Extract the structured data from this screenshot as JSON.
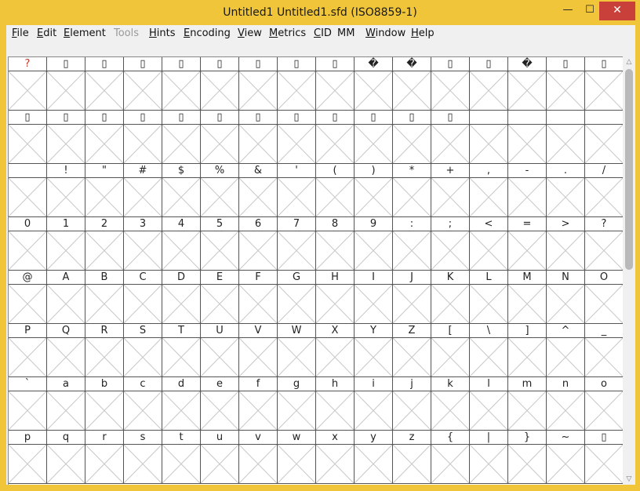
{
  "window": {
    "title": "Untitled1  Untitled1.sfd (ISO8859-1)",
    "minimize_glyph": "—",
    "maximize_glyph": "☐",
    "close_glyph": "✕"
  },
  "menu": [
    {
      "mnemonic": "F",
      "rest": "ile",
      "enabled": true
    },
    {
      "mnemonic": "E",
      "rest": "dit",
      "enabled": true
    },
    {
      "mnemonic": "E",
      "rest": "lement",
      "enabled": true
    },
    {
      "mnemonic": "",
      "rest": "Tools",
      "enabled": false
    },
    {
      "mnemonic": "H",
      "rest": "ints",
      "enabled": true
    },
    {
      "mnemonic": "E",
      "rest": "ncoding",
      "enabled": true
    },
    {
      "mnemonic": "V",
      "rest": "iew",
      "enabled": true
    },
    {
      "mnemonic": "M",
      "rest": "etrics",
      "enabled": true
    },
    {
      "mnemonic": "C",
      "rest": "ID",
      "enabled": true
    },
    {
      "mnemonic": "",
      "rest": "MM",
      "enabled": true
    },
    {
      "mnemonic": "W",
      "rest": "indow",
      "enabled": true
    },
    {
      "mnemonic": "H",
      "rest": "elp",
      "enabled": true
    }
  ],
  "glyph_rows": [
    [
      "?",
      "▯",
      "▯",
      "▯",
      "▯",
      "▯",
      "▯",
      "▯",
      "▯",
      "�",
      "�",
      "▯",
      "▯",
      "�",
      "▯",
      "▯"
    ],
    [
      "▯",
      "▯",
      "▯",
      "▯",
      "▯",
      "▯",
      "▯",
      "▯",
      "▯",
      "▯",
      "▯",
      "▯",
      "",
      "",
      "",
      ""
    ],
    [
      "",
      "!",
      "\"",
      "#",
      "$",
      "%",
      "&",
      "'",
      "(",
      ")",
      "*",
      "+",
      ",",
      "-",
      ".",
      "/"
    ],
    [
      "0",
      "1",
      "2",
      "3",
      "4",
      "5",
      "6",
      "7",
      "8",
      "9",
      ":",
      ";",
      "<",
      "=",
      ">",
      "?"
    ],
    [
      "@",
      "A",
      "B",
      "C",
      "D",
      "E",
      "F",
      "G",
      "H",
      "I",
      "J",
      "K",
      "L",
      "M",
      "N",
      "O"
    ],
    [
      "P",
      "Q",
      "R",
      "S",
      "T",
      "U",
      "V",
      "W",
      "X",
      "Y",
      "Z",
      "[",
      "\\",
      "]",
      "^",
      "_"
    ],
    [
      "`",
      "a",
      "b",
      "c",
      "d",
      "e",
      "f",
      "g",
      "h",
      "i",
      "j",
      "k",
      "l",
      "m",
      "n",
      "o"
    ],
    [
      "p",
      "q",
      "r",
      "s",
      "t",
      "u",
      "v",
      "w",
      "x",
      "y",
      "z",
      "{",
      "|",
      "}",
      "~",
      "▯"
    ]
  ],
  "colors": {
    "title_bar": "#f0c53a",
    "close_button": "#c9403a",
    "highlight_label": "#c0392b"
  }
}
